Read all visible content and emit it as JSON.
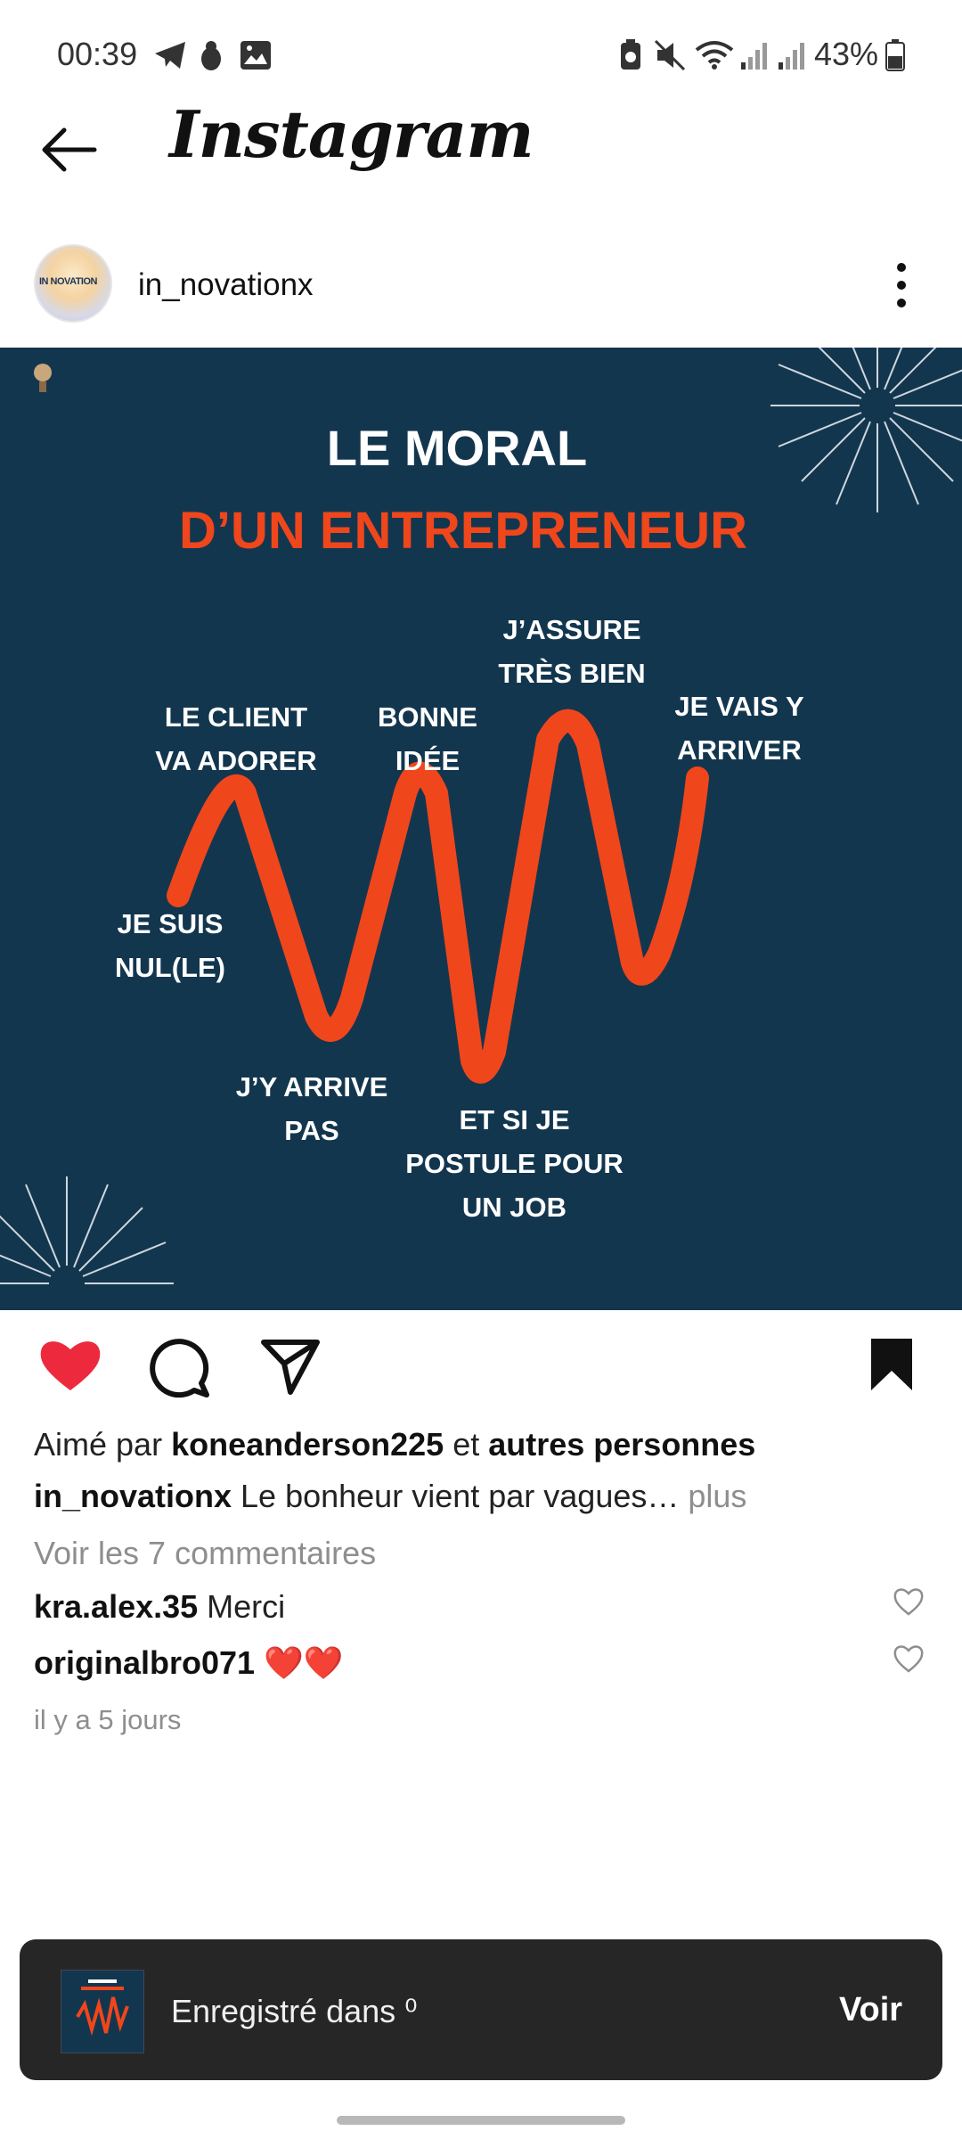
{
  "status_bar": {
    "time": "00:39",
    "battery_pct": "43%",
    "icons_left": [
      "telegram-icon",
      "bug-icon",
      "gallery-icon"
    ],
    "icons_right": [
      "battery-saver-icon",
      "mute-icon",
      "wifi-icon",
      "signal-icon",
      "signal-icon",
      "battery-icon"
    ]
  },
  "header": {
    "title": "Instagram"
  },
  "post": {
    "username": "in_novationx",
    "avatar_text": "IN NOVATION",
    "image": {
      "title_line1": "LE MORAL",
      "title_line2": "D’UN ENTREPRENEUR",
      "accent_color": "#f0461c",
      "background_color": "#13364f",
      "labels": {
        "je_suis": "JE SUIS",
        "nul": "NUL(LE)",
        "client1": "LE CLIENT",
        "client2": "VA ADORER",
        "arrive1": "J’Y ARRIVE",
        "arrive2": "PAS",
        "bonne1": "BONNE",
        "bonne2": "IDÉE",
        "postule1": "ET SI JE",
        "postule2": "POSTULE POUR",
        "postule3": "UN JOB",
        "assure1": "J’ASSURE",
        "assure2": "TRÈS BIEN",
        "vais1": "JE VAIS Y",
        "vais2": "ARRIVER"
      }
    },
    "liked_prefix": "Aimé par ",
    "liked_user": "koneanderson225",
    "liked_and": " et ",
    "liked_others": "autres personnes",
    "caption_user": "in_novationx",
    "caption_text": " Le bonheur vient par vagues…",
    "caption_more": " plus",
    "view_comments": "Voir les 7 commentaires",
    "comments": [
      {
        "user": "kra.alex.35",
        "text": " Merci"
      },
      {
        "user": "originalbro071",
        "text": " ❤️❤️"
      }
    ],
    "time_ago": "il y a 5 jours",
    "liked": true,
    "saved": true
  },
  "toast": {
    "text": "Enregistré dans ⁰",
    "button": "Voir"
  }
}
